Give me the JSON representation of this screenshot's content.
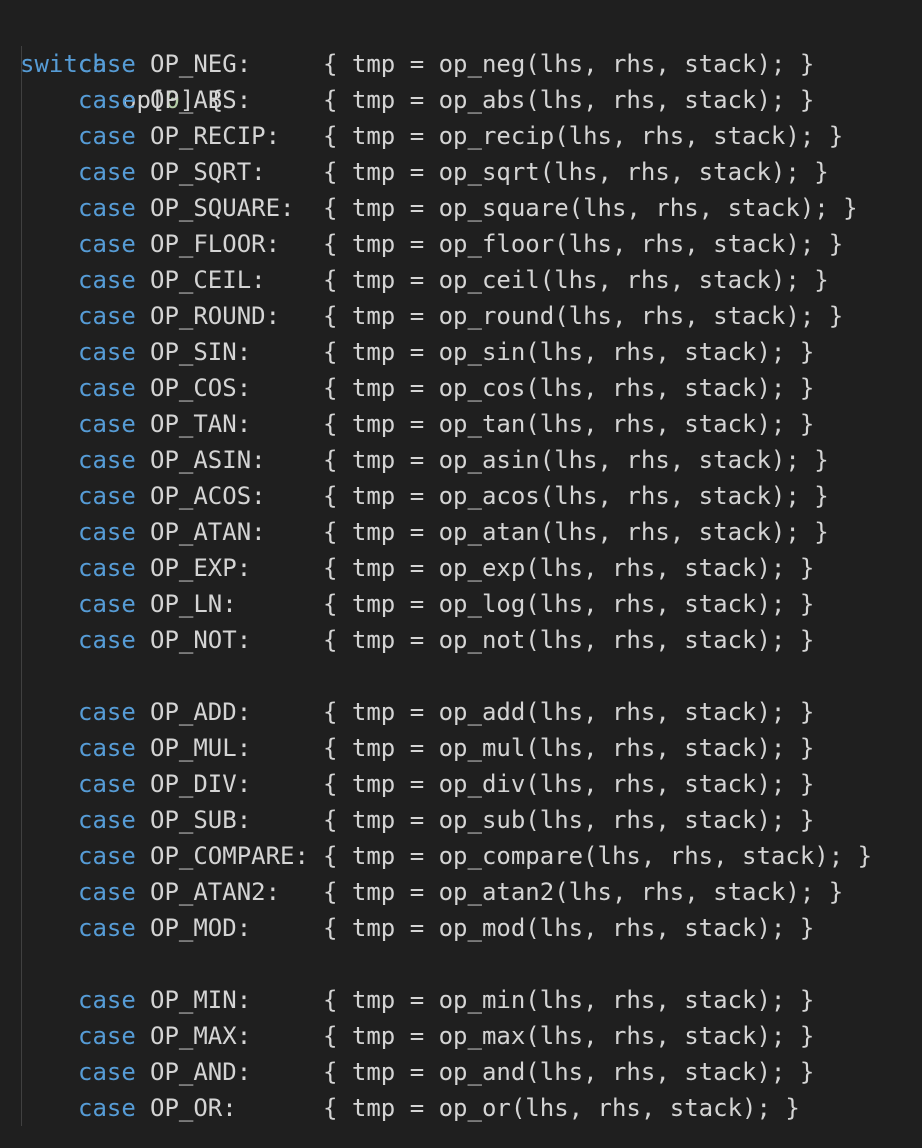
{
  "code": {
    "header": {
      "keyword": "switch",
      "expr_prefix": "op[",
      "expr_index": "0",
      "expr_suffix": "] {"
    },
    "groups": [
      [
        {
          "keyword": "case",
          "label": "OP_NEG:",
          "body": "{ tmp = op_neg(lhs, rhs, stack); }"
        },
        {
          "keyword": "case",
          "label": "OP_ABS:",
          "body": "{ tmp = op_abs(lhs, rhs, stack); }"
        },
        {
          "keyword": "case",
          "label": "OP_RECIP:",
          "body": "{ tmp = op_recip(lhs, rhs, stack); }"
        },
        {
          "keyword": "case",
          "label": "OP_SQRT:",
          "body": "{ tmp = op_sqrt(lhs, rhs, stack); }"
        },
        {
          "keyword": "case",
          "label": "OP_SQUARE:",
          "body": "{ tmp = op_square(lhs, rhs, stack); }"
        },
        {
          "keyword": "case",
          "label": "OP_FLOOR:",
          "body": "{ tmp = op_floor(lhs, rhs, stack); }"
        },
        {
          "keyword": "case",
          "label": "OP_CEIL:",
          "body": "{ tmp = op_ceil(lhs, rhs, stack); }"
        },
        {
          "keyword": "case",
          "label": "OP_ROUND:",
          "body": "{ tmp = op_round(lhs, rhs, stack); }"
        },
        {
          "keyword": "case",
          "label": "OP_SIN:",
          "body": "{ tmp = op_sin(lhs, rhs, stack); }"
        },
        {
          "keyword": "case",
          "label": "OP_COS:",
          "body": "{ tmp = op_cos(lhs, rhs, stack); }"
        },
        {
          "keyword": "case",
          "label": "OP_TAN:",
          "body": "{ tmp = op_tan(lhs, rhs, stack); }"
        },
        {
          "keyword": "case",
          "label": "OP_ASIN:",
          "body": "{ tmp = op_asin(lhs, rhs, stack); }"
        },
        {
          "keyword": "case",
          "label": "OP_ACOS:",
          "body": "{ tmp = op_acos(lhs, rhs, stack); }"
        },
        {
          "keyword": "case",
          "label": "OP_ATAN:",
          "body": "{ tmp = op_atan(lhs, rhs, stack); }"
        },
        {
          "keyword": "case",
          "label": "OP_EXP:",
          "body": "{ tmp = op_exp(lhs, rhs, stack); }"
        },
        {
          "keyword": "case",
          "label": "OP_LN:",
          "body": "{ tmp = op_log(lhs, rhs, stack); }"
        },
        {
          "keyword": "case",
          "label": "OP_NOT:",
          "body": "{ tmp = op_not(lhs, rhs, stack); }"
        }
      ],
      [
        {
          "keyword": "case",
          "label": "OP_ADD:",
          "body": "{ tmp = op_add(lhs, rhs, stack); }"
        },
        {
          "keyword": "case",
          "label": "OP_MUL:",
          "body": "{ tmp = op_mul(lhs, rhs, stack); }"
        },
        {
          "keyword": "case",
          "label": "OP_DIV:",
          "body": "{ tmp = op_div(lhs, rhs, stack); }"
        },
        {
          "keyword": "case",
          "label": "OP_SUB:",
          "body": "{ tmp = op_sub(lhs, rhs, stack); }"
        },
        {
          "keyword": "case",
          "label": "OP_COMPARE:",
          "body": "{ tmp = op_compare(lhs, rhs, stack); }"
        },
        {
          "keyword": "case",
          "label": "OP_ATAN2:",
          "body": "{ tmp = op_atan2(lhs, rhs, stack); }"
        },
        {
          "keyword": "case",
          "label": "OP_MOD:",
          "body": "{ tmp = op_mod(lhs, rhs, stack); }"
        }
      ],
      [
        {
          "keyword": "case",
          "label": "OP_MIN:",
          "body": "{ tmp = op_min(lhs, rhs, stack); }"
        },
        {
          "keyword": "case",
          "label": "OP_MAX:",
          "body": "{ tmp = op_max(lhs, rhs, stack); }"
        },
        {
          "keyword": "case",
          "label": "OP_AND:",
          "body": "{ tmp = op_and(lhs, rhs, stack); }"
        },
        {
          "keyword": "case",
          "label": "OP_OR:",
          "body": "{ tmp = op_or(lhs, rhs, stack); }"
        }
      ]
    ]
  },
  "colors": {
    "background": "#1f1f1f",
    "keyword": "#569cd6",
    "text": "#d4d4d4",
    "number": "#b5cea8",
    "indent_guide": "#404040"
  }
}
